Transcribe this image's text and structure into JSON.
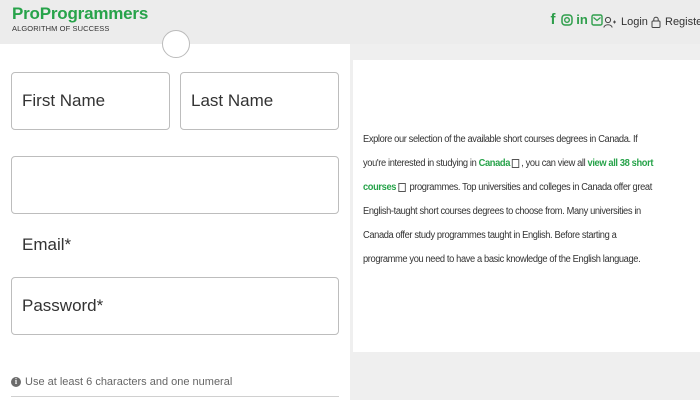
{
  "header": {
    "brand": "ProProgrammers",
    "tagline": "ALGORITHM OF SUCCESS",
    "social": [
      {
        "name": "facebook-icon",
        "glyph": "f"
      },
      {
        "name": "instagram-icon",
        "glyph": "◎"
      },
      {
        "name": "linkedin-icon",
        "glyph": "in"
      },
      {
        "name": "email-icon",
        "glyph": "✉"
      }
    ],
    "login_label": "Login",
    "register_label": "Register"
  },
  "form": {
    "first_name_placeholder": "First Name",
    "last_name_placeholder": "Last Name",
    "blank_value": "",
    "email_label": "Email*",
    "password_placeholder": "Password*",
    "password_hint": "Use at least 6 characters and one numeral"
  },
  "info": {
    "part1": "Explore our selection of the available short courses degrees in Canada. If you're interested in studying in ",
    "canada_link": "Canada",
    "part2": ", you can view all ",
    "courses_link": "view all 38 short courses",
    "part3": " programmes. Top universities and colleges in Canada offer great English-taught short courses degrees to choose from. Many universities in Canada offer study programmes taught in English. Before starting a programme you need to have a basic knowledge of the English language."
  },
  "colors": {
    "brand": "#27a34a",
    "header_bg": "#ececec",
    "panel_bg": "#efefef"
  }
}
